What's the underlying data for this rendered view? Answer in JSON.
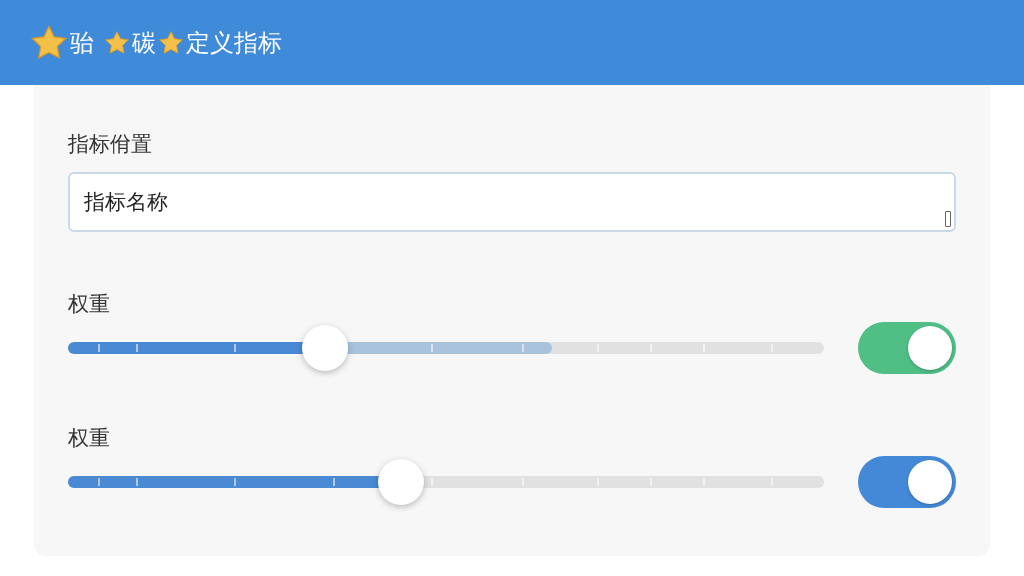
{
  "header": {
    "title_segments": [
      {
        "text": "骀"
      },
      {
        "text": "碳"
      },
      {
        "text": "定义指标"
      }
    ]
  },
  "field": {
    "label": "指标佾置",
    "value": "指标名称"
  },
  "sliders": [
    {
      "label": "权重",
      "level": 0.34,
      "toggle": {
        "on": true,
        "color": "#4fbf85"
      }
    },
    {
      "label": "权重",
      "level": 0.44,
      "toggle": {
        "on": true,
        "color": "#4489d8"
      }
    }
  ]
}
